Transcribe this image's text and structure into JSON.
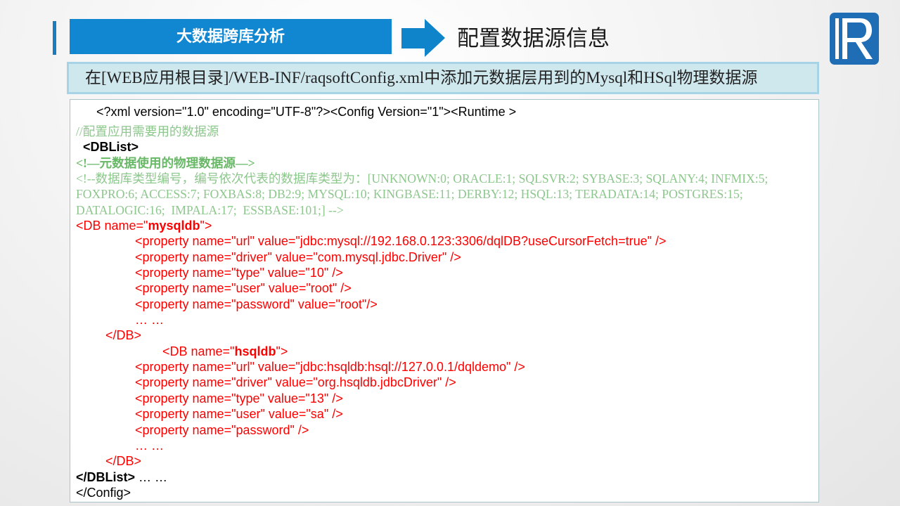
{
  "header": {
    "section_title": "大数据跨库分析",
    "page_title": "配置数据源信息"
  },
  "banner": {
    "text": "在[WEB应用根目录]/WEB-INF/raqsoftConfig.xml中添加元数据层用到的Mysql和HSql物理数据源"
  },
  "icons": {
    "arrow": "right-arrow-icon",
    "logo": "raqsoft-logo-icon"
  },
  "colors": {
    "primary_blue": "#1187d1",
    "arrow_blue": "#0f84ca",
    "accent_bar": "#1a7bbf",
    "banner_bg": "#cfe8ee",
    "banner_border": "#a6d3e6",
    "tag_red": "#ff0000",
    "comment_green": "#8cc78c",
    "comment_green_bold": "#68b868",
    "code_border": "#a9c3c9",
    "logo_blue": "#1f6db5"
  },
  "code": {
    "xml_declaration": "<?xml version=\"1.0\" encoding=\"UTF-8\"?><Config Version=\"1\"><Runtime >",
    "comment_datasource": "//配置应用需要用的数据源",
    "dblist_open": "<DBList>",
    "comment_metadata": "<!—元数据使用的物理数据源—>",
    "comment_db_types": [
      "<!--数据库类型编号，编号依次代表的数据库类型为：[UNKNOWN:0; ORACLE:1; SQLSVR:2; SYBASE:3; SQLANY:4; INFMIX:5;",
      "FOXPRO:6; ACCESS:7; FOXBAS:8; DB2:9; MYSQL:10; KINGBASE:11; DERBY:12; HSQL:13; TERADATA:14; POSTGRES:15;",
      "DATALOGIC:16;  IMPALA:17;  ESSBASE:101;] -->"
    ],
    "mysql": {
      "open_prefix": "<DB name=\"",
      "name": "mysqldb",
      "open_suffix": "\">",
      "properties": [
        "<property name=\"url\" value=\"jdbc:mysql://192.168.0.123:3306/dqlDB?useCursorFetch=true\" />",
        "<property name=\"driver\" value=\"com.mysql.jdbc.Driver\" />",
        "<property name=\"type\" value=\"10\" />",
        "<property name=\"user\" value=\"root\" />",
        "<property name=\"password\" value=\"root\"/>"
      ],
      "ellipsis": "… …",
      "close": "</DB>"
    },
    "hsql": {
      "open_prefix": "<DB name=\"",
      "name": "hsqldb",
      "open_suffix": "\">",
      "properties": [
        "<property name=\"url\" value=\"jdbc:hsqldb:hsql://127.0.0.1/dqldemo\" />",
        "<property name=\"driver\" value=\"org.hsqldb.jdbcDriver\" />",
        "<property name=\"type\" value=\"13\" />",
        "<property name=\"user\" value=\"sa\" />",
        "<property name=\"password\" />"
      ],
      "ellipsis": "… …",
      "close": "</DB>"
    },
    "dblist_close": "</DBList>",
    "dblist_trailing": " … …",
    "config_close": "</Config>"
  }
}
